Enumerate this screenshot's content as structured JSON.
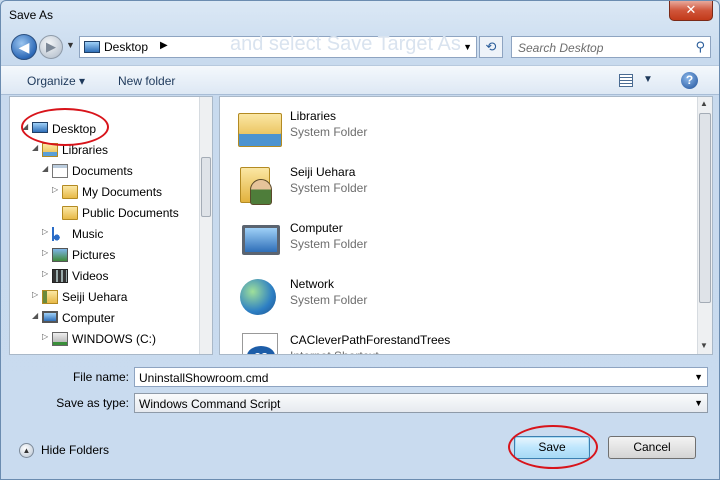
{
  "window": {
    "title": "Save As",
    "close_glyph": "✕"
  },
  "nav": {
    "back_glyph": "◀",
    "forward_glyph": "▶",
    "address_location": "Desktop",
    "address_arrow": "▶",
    "address_ghost_text": "and select Save Target As",
    "refresh_glyph": "⟲",
    "search_placeholder": "Search Desktop",
    "search_icon": "search-icon"
  },
  "toolbar": {
    "organize_label": "Organize ▾",
    "new_folder_label": "New folder",
    "help_label": "?"
  },
  "tree": [
    {
      "label": "Desktop",
      "icon": "desktop-icon",
      "expander": "◢",
      "level": 0
    },
    {
      "label": "Libraries",
      "icon": "library-icon",
      "expander": "◢",
      "level": 1
    },
    {
      "label": "Documents",
      "icon": "documents-icon",
      "expander": "◢",
      "level": 2
    },
    {
      "label": "My Documents",
      "icon": "folder-icon",
      "expander": "▷",
      "level": 3
    },
    {
      "label": "Public Documents",
      "icon": "folder-icon",
      "expander": "",
      "level": 3
    },
    {
      "label": "Music",
      "icon": "music-icon",
      "expander": "▷",
      "level": 2
    },
    {
      "label": "Pictures",
      "icon": "pictures-icon",
      "expander": "▷",
      "level": 2
    },
    {
      "label": "Videos",
      "icon": "videos-icon",
      "expander": "▷",
      "level": 2
    },
    {
      "label": "Seiji Uehara",
      "icon": "user-folder-icon",
      "expander": "▷",
      "level": 1
    },
    {
      "label": "Computer",
      "icon": "computer-icon",
      "expander": "◢",
      "level": 1
    },
    {
      "label": "WINDOWS (C:)",
      "icon": "drive-icon",
      "expander": "▷",
      "level": 2
    }
  ],
  "files": [
    {
      "name": "Libraries",
      "type": "System Folder",
      "icon": "libraries-icon"
    },
    {
      "name": "Seiji Uehara",
      "type": "System Folder",
      "icon": "user-folder-icon"
    },
    {
      "name": "Computer",
      "type": "System Folder",
      "icon": "computer-icon"
    },
    {
      "name": "Network",
      "type": "System Folder",
      "icon": "network-icon"
    },
    {
      "name": "CACleverPathForestandTrees",
      "type": "Internet Shortcut",
      "icon": "shortcut-icon",
      "badge": "ca"
    }
  ],
  "form": {
    "file_name_label": "File name:",
    "file_name_value": "UninstallShowroom.cmd",
    "save_as_type_label": "Save as type:",
    "save_as_type_value": "Windows Command Script"
  },
  "footer": {
    "hide_folders_label": "Hide Folders",
    "hide_folders_glyph": "▲",
    "save_label": "Save",
    "cancel_label": "Cancel"
  },
  "annotations": {
    "ring_color": "#d8141b"
  }
}
